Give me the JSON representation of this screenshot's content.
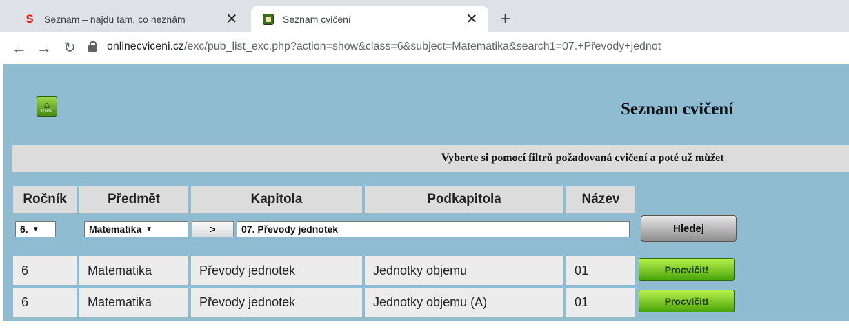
{
  "browser": {
    "tabs": [
      {
        "title": "Seznam – najdu tam, co neznám",
        "favicon": "seznam-s-icon"
      },
      {
        "title": "Seznam cvičení",
        "favicon": "home-icon",
        "active": true
      }
    ],
    "url_host": "onlinecviceni.cz",
    "url_path": "/exc/pub_list_exc.php?action=show&class=6&subject=Matematika&search1=07.+Převody+jednot"
  },
  "page": {
    "home_label": "Domů",
    "title": "Seznam cvičení",
    "info": "Vyberte si pomocí filtrů požadovaná cvičení a poté už můžet"
  },
  "table": {
    "headers": [
      "Ročník",
      "Předmět",
      "Kapitola",
      "Podkapitola",
      "Název"
    ],
    "filter": {
      "rocnik": "6.",
      "predmet": "Matematika",
      "go_label": ">",
      "search_value": "07. Převody jednotek",
      "search_button": "Hledej"
    },
    "rows": [
      {
        "rocnik": "6",
        "predmet": "Matematika",
        "kapitola": "Převody jednotek",
        "podkapitola": "Jednotky objemu",
        "nazev": "01",
        "action": "Procvičit!"
      },
      {
        "rocnik": "6",
        "predmet": "Matematika",
        "kapitola": "Převody jednotek",
        "podkapitola": "Jednotky objemu (A)",
        "nazev": "01",
        "action": "Procvičit!"
      }
    ]
  }
}
